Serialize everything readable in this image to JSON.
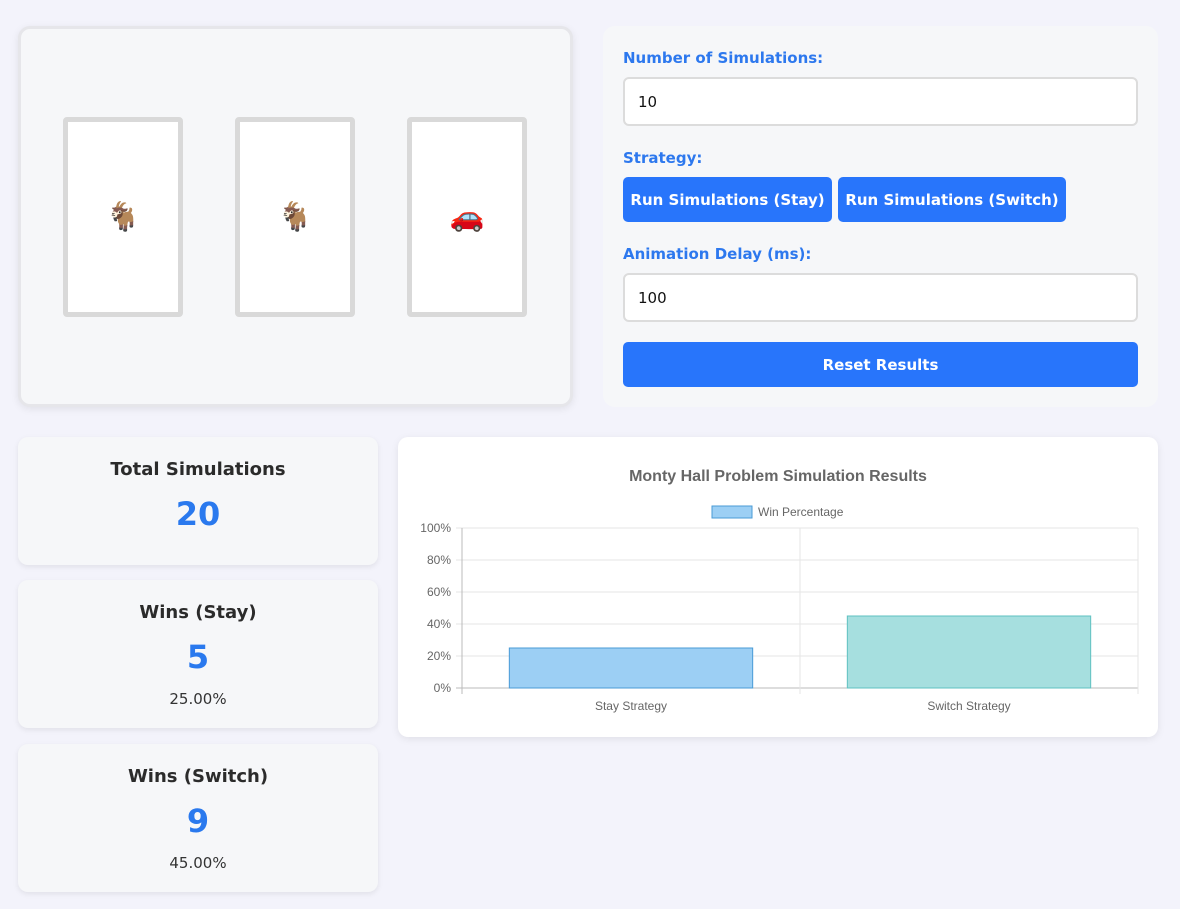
{
  "doors": [
    {
      "icon": "goat-icon",
      "glyph": "🐐"
    },
    {
      "icon": "goat-icon",
      "glyph": "🐐"
    },
    {
      "icon": "car-icon",
      "glyph": "🚗"
    }
  ],
  "controls": {
    "num_sims_label": "Number of Simulations:",
    "num_sims_value": "10",
    "strategy_label": "Strategy:",
    "run_stay_label": "Run Simulations (Stay)",
    "run_switch_label": "Run Simulations (Switch)",
    "delay_label": "Animation Delay (ms):",
    "delay_value": "100",
    "reset_label": "Reset Results"
  },
  "stats": {
    "total": {
      "title": "Total Simulations",
      "value": "20"
    },
    "stay": {
      "title": "Wins (Stay)",
      "value": "5",
      "pct": "25.00%"
    },
    "switch": {
      "title": "Wins (Switch)",
      "value": "9",
      "pct": "45.00%"
    }
  },
  "colors": {
    "accent": "#2875fb",
    "stay_bar": "#9ccff4",
    "stay_border": "#4a9bd6",
    "switch_bar": "#a6dfdf",
    "switch_border": "#5fc1c1"
  },
  "chart_data": {
    "type": "bar",
    "title": "Monty Hall Problem Simulation Results",
    "categories": [
      "Stay Strategy",
      "Switch Strategy"
    ],
    "series": [
      {
        "name": "Win Percentage",
        "values": [
          25,
          45
        ]
      }
    ],
    "ylim": [
      0,
      100
    ],
    "yticks": [
      "0%",
      "20%",
      "40%",
      "60%",
      "80%",
      "100%"
    ],
    "legend": "top",
    "grid": true
  }
}
